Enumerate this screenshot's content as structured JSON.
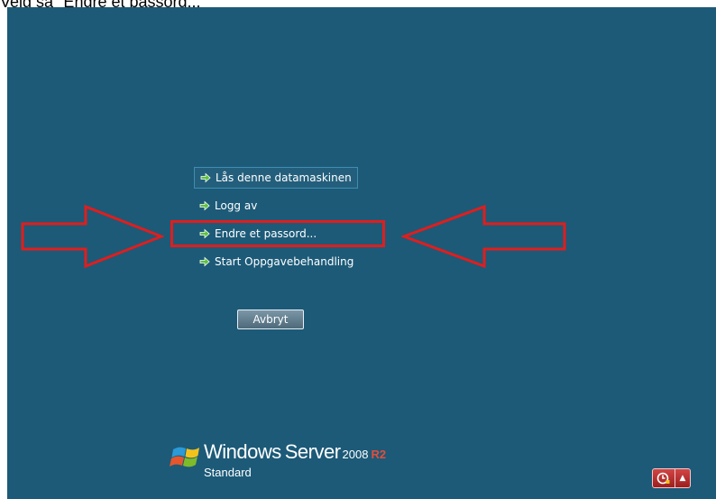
{
  "caption": "Velg så \"Endre et passord...\"",
  "menu": {
    "items": [
      {
        "label": "Lås denne datamaskinen",
        "focused": true
      },
      {
        "label": "Logg av",
        "focused": false
      },
      {
        "label": "Endre et passord...",
        "focused": false
      },
      {
        "label": "Start Oppgavebehandling",
        "focused": false
      }
    ],
    "cancel_label": "Avbryt"
  },
  "logo": {
    "brand": "Windows",
    "product": "Server",
    "version": "2008",
    "release": "R2",
    "edition": "Standard"
  },
  "icons": {
    "menu_item": "green-arrow-icon",
    "ease_of_access": "ease-of-access-icon",
    "ease_menu": "caret-up-icon"
  },
  "colors": {
    "background": "#1c5a78",
    "annotation": "#e11d1d",
    "arrow_icon": "#5cc23a",
    "release_accent": "#e34d3b"
  }
}
